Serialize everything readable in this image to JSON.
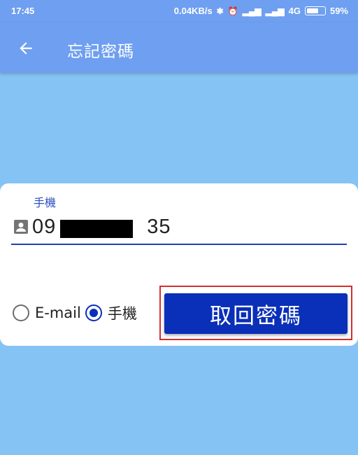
{
  "status_bar": {
    "time": "17:45",
    "speed": "0.04KB/s",
    "network": "4G",
    "battery": "59%",
    "battery_level": 0.59
  },
  "app_bar": {
    "back_icon": "arrow-left-icon",
    "title": "忘記密碼"
  },
  "form": {
    "phone_label": "手機",
    "phone_prefix": "09",
    "phone_suffix": "35",
    "phone_icon": "contact-card-icon",
    "radio_options": [
      {
        "label": "E-mail",
        "checked": false
      },
      {
        "label": "手機",
        "checked": true
      }
    ],
    "submit_label": "取回密碼"
  },
  "colors": {
    "background": "#85c3f5",
    "app_bar": "#6e9ff0",
    "primary": "#0a2fb8",
    "highlight": "#d32f2f"
  }
}
